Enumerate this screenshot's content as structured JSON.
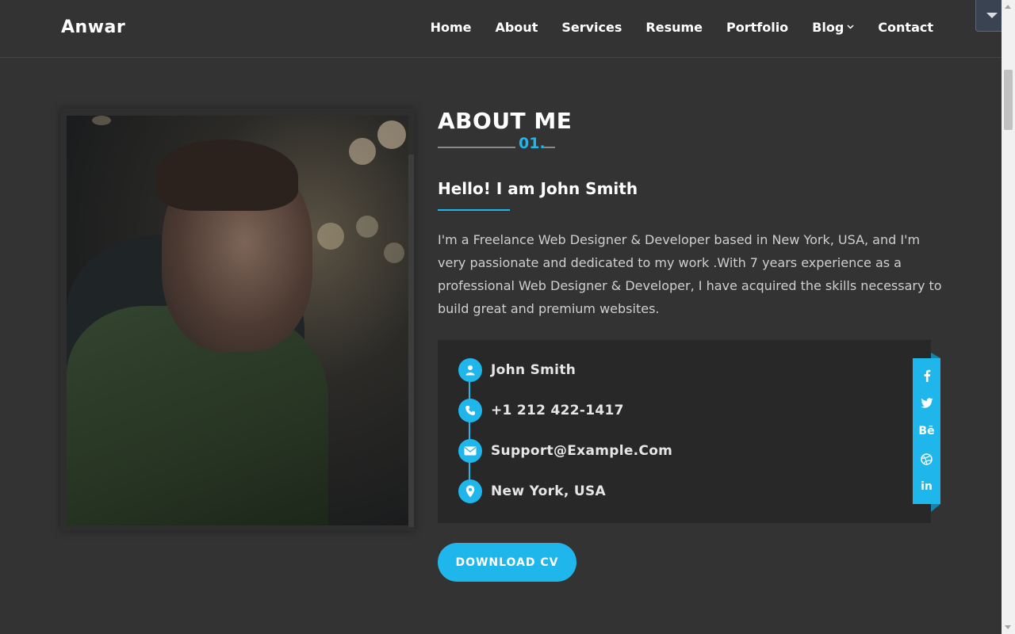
{
  "header": {
    "logo": "Anwar",
    "nav": [
      "Home",
      "About",
      "Services",
      "Resume",
      "Portfolio",
      "Blog",
      "Contact"
    ],
    "blog_caret": "⌄"
  },
  "about": {
    "title": "ABOUT ME",
    "number": "01.",
    "hello": "Hello! I am John Smith",
    "bio": "I'm a Freelance Web Designer & Developer based in New York, USA, and I'm very passionate and dedicated to my work .With 7 years experience as a professional Web Designer & Developer, I have acquired the skills necessary to build great and premium websites.",
    "info": [
      {
        "icon": "user-icon",
        "text": "John Smith"
      },
      {
        "icon": "phone-icon",
        "text": "+1 212 422-1417"
      },
      {
        "icon": "envelope-icon",
        "text": "Support@Example.Com"
      },
      {
        "icon": "map-marker-icon",
        "text": "New York, USA"
      }
    ],
    "social": [
      {
        "icon": "facebook-icon",
        "glyph": "f"
      },
      {
        "icon": "twitter-icon",
        "glyph": "🐦"
      },
      {
        "icon": "behance-icon",
        "glyph": "Bē"
      },
      {
        "icon": "dribbble-icon",
        "glyph": "⊛"
      },
      {
        "icon": "linkedin-icon",
        "glyph": "in"
      }
    ],
    "download_label": "DOWNLOAD CV"
  },
  "colors": {
    "accent": "#1fb6ec",
    "background": "#333333",
    "panel": "#282828"
  }
}
